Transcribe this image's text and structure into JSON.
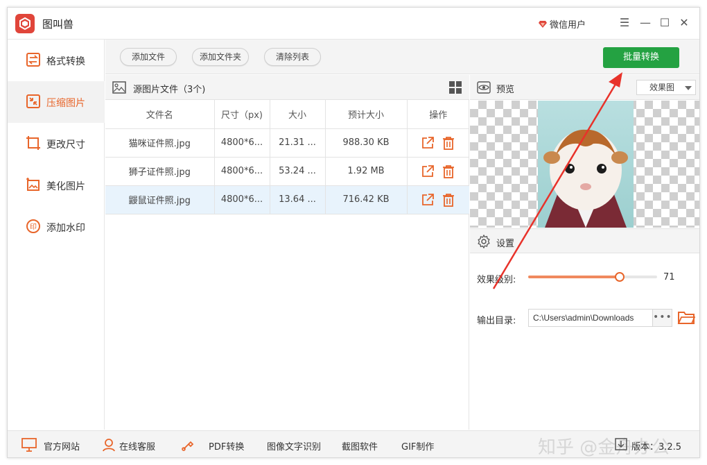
{
  "app": {
    "title": "图叫兽",
    "user": "微信用户"
  },
  "window_controls": {
    "menu": "☰",
    "minimize": "—",
    "maximize": "☐",
    "close": "✕"
  },
  "sidebar": {
    "items": [
      {
        "label": "格式转换",
        "icon": "format-convert-icon",
        "active": false
      },
      {
        "label": "压缩图片",
        "icon": "compress-icon",
        "active": true
      },
      {
        "label": "更改尺寸",
        "icon": "resize-icon",
        "active": false
      },
      {
        "label": "美化图片",
        "icon": "beautify-icon",
        "active": false
      },
      {
        "label": "添加水印",
        "icon": "watermark-icon",
        "active": false
      }
    ]
  },
  "toolbar": {
    "add_file": "添加文件",
    "add_folder": "添加文件夹",
    "clear_list": "清除列表",
    "batch_convert": "批量转换"
  },
  "files": {
    "title": "源图片文件（3个)",
    "columns": [
      "文件名",
      "尺寸（px)",
      "大小",
      "预计大小",
      "操作"
    ],
    "rows": [
      {
        "name": "猫咪证件照.jpg",
        "dimensions": "4800*6...",
        "size": "21.31 ...",
        "estimated": "988.30 KB"
      },
      {
        "name": "狮子证件照.jpg",
        "dimensions": "4800*6...",
        "size": "53.24 ...",
        "estimated": "1.92 MB"
      },
      {
        "name": "鼹鼠证件照.jpg",
        "dimensions": "4800*6...",
        "size": "13.64 ...",
        "estimated": "716.42 KB"
      }
    ],
    "selected_row": 2
  },
  "preview": {
    "title": "预览",
    "mode": "效果图"
  },
  "settings": {
    "title": "设置",
    "level_label": "效果级别:",
    "level_value": "71",
    "level_fraction": 0.71,
    "output_label": "输出目录:",
    "output_path": "C:\\Users\\admin\\Downloads",
    "browse": "•••"
  },
  "footer": {
    "website": "官方网站",
    "support": "在线客服",
    "pdf": "PDF转换",
    "ocr": "图像文字识别",
    "screenshot": "截图软件",
    "gif": "GIF制作",
    "watermark_text": "知乎 @金舟办公",
    "version": "版本：3.2.5"
  },
  "colors": {
    "accent": "#e8652a",
    "primary_green": "#24a242",
    "annotation_red": "#e8322a"
  }
}
